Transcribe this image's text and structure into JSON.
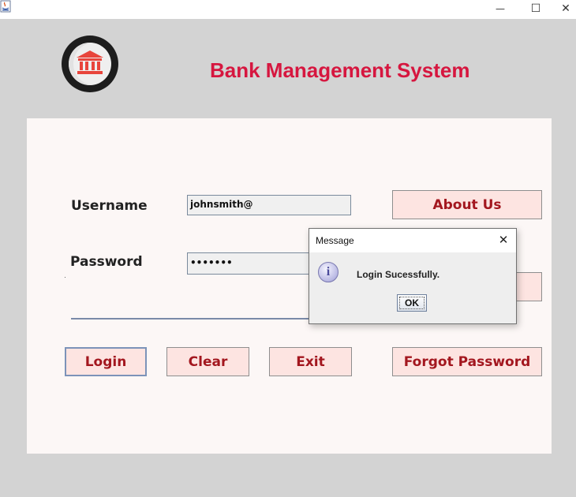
{
  "window": {
    "minimize_glyph": "—",
    "maximize_glyph": "☐",
    "close_glyph": "✕"
  },
  "header": {
    "title": "Bank Management System",
    "logo_icon": "bank-building-icon",
    "title_color": "#d6163f"
  },
  "form": {
    "username_label": "Username",
    "username_value": "johnsmith@",
    "password_label": "Password",
    "password_value": "•••••••"
  },
  "buttons": {
    "about_us": "About Us",
    "login": "Login",
    "clear": "Clear",
    "exit": "Exit",
    "forgot_password": "Forgot Password"
  },
  "dialog": {
    "title": "Message",
    "close_glyph": "✕",
    "icon": "info-icon",
    "icon_glyph": "i",
    "message": "Login Sucessfully.",
    "ok_label": "OK"
  },
  "colors": {
    "button_bg": "#fde4e1",
    "button_text": "#a3171f",
    "panel_bg": "#fcf7f6",
    "window_bg": "#d3d3d3"
  }
}
